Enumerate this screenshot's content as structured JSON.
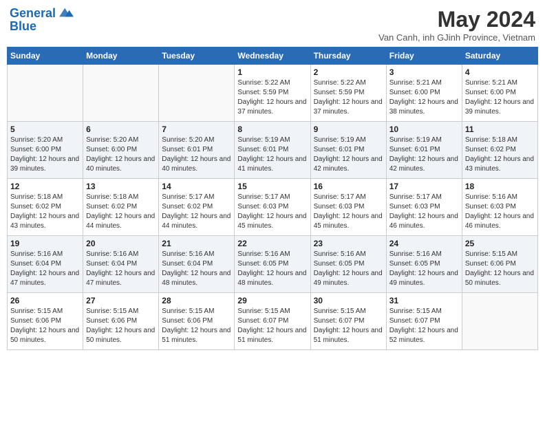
{
  "header": {
    "logo_line1": "General",
    "logo_line2": "Blue",
    "month_title": "May 2024",
    "subtitle": "Van Canh, inh GJinh Province, Vietnam"
  },
  "weekdays": [
    "Sunday",
    "Monday",
    "Tuesday",
    "Wednesday",
    "Thursday",
    "Friday",
    "Saturday"
  ],
  "weeks": [
    [
      {
        "day": "",
        "sunrise": "",
        "sunset": "",
        "daylight": ""
      },
      {
        "day": "",
        "sunrise": "",
        "sunset": "",
        "daylight": ""
      },
      {
        "day": "",
        "sunrise": "",
        "sunset": "",
        "daylight": ""
      },
      {
        "day": "1",
        "sunrise": "Sunrise: 5:22 AM",
        "sunset": "Sunset: 5:59 PM",
        "daylight": "Daylight: 12 hours and 37 minutes."
      },
      {
        "day": "2",
        "sunrise": "Sunrise: 5:22 AM",
        "sunset": "Sunset: 5:59 PM",
        "daylight": "Daylight: 12 hours and 37 minutes."
      },
      {
        "day": "3",
        "sunrise": "Sunrise: 5:21 AM",
        "sunset": "Sunset: 6:00 PM",
        "daylight": "Daylight: 12 hours and 38 minutes."
      },
      {
        "day": "4",
        "sunrise": "Sunrise: 5:21 AM",
        "sunset": "Sunset: 6:00 PM",
        "daylight": "Daylight: 12 hours and 39 minutes."
      }
    ],
    [
      {
        "day": "5",
        "sunrise": "Sunrise: 5:20 AM",
        "sunset": "Sunset: 6:00 PM",
        "daylight": "Daylight: 12 hours and 39 minutes."
      },
      {
        "day": "6",
        "sunrise": "Sunrise: 5:20 AM",
        "sunset": "Sunset: 6:00 PM",
        "daylight": "Daylight: 12 hours and 40 minutes."
      },
      {
        "day": "7",
        "sunrise": "Sunrise: 5:20 AM",
        "sunset": "Sunset: 6:01 PM",
        "daylight": "Daylight: 12 hours and 40 minutes."
      },
      {
        "day": "8",
        "sunrise": "Sunrise: 5:19 AM",
        "sunset": "Sunset: 6:01 PM",
        "daylight": "Daylight: 12 hours and 41 minutes."
      },
      {
        "day": "9",
        "sunrise": "Sunrise: 5:19 AM",
        "sunset": "Sunset: 6:01 PM",
        "daylight": "Daylight: 12 hours and 42 minutes."
      },
      {
        "day": "10",
        "sunrise": "Sunrise: 5:19 AM",
        "sunset": "Sunset: 6:01 PM",
        "daylight": "Daylight: 12 hours and 42 minutes."
      },
      {
        "day": "11",
        "sunrise": "Sunrise: 5:18 AM",
        "sunset": "Sunset: 6:02 PM",
        "daylight": "Daylight: 12 hours and 43 minutes."
      }
    ],
    [
      {
        "day": "12",
        "sunrise": "Sunrise: 5:18 AM",
        "sunset": "Sunset: 6:02 PM",
        "daylight": "Daylight: 12 hours and 43 minutes."
      },
      {
        "day": "13",
        "sunrise": "Sunrise: 5:18 AM",
        "sunset": "Sunset: 6:02 PM",
        "daylight": "Daylight: 12 hours and 44 minutes."
      },
      {
        "day": "14",
        "sunrise": "Sunrise: 5:17 AM",
        "sunset": "Sunset: 6:02 PM",
        "daylight": "Daylight: 12 hours and 44 minutes."
      },
      {
        "day": "15",
        "sunrise": "Sunrise: 5:17 AM",
        "sunset": "Sunset: 6:03 PM",
        "daylight": "Daylight: 12 hours and 45 minutes."
      },
      {
        "day": "16",
        "sunrise": "Sunrise: 5:17 AM",
        "sunset": "Sunset: 6:03 PM",
        "daylight": "Daylight: 12 hours and 45 minutes."
      },
      {
        "day": "17",
        "sunrise": "Sunrise: 5:17 AM",
        "sunset": "Sunset: 6:03 PM",
        "daylight": "Daylight: 12 hours and 46 minutes."
      },
      {
        "day": "18",
        "sunrise": "Sunrise: 5:16 AM",
        "sunset": "Sunset: 6:03 PM",
        "daylight": "Daylight: 12 hours and 46 minutes."
      }
    ],
    [
      {
        "day": "19",
        "sunrise": "Sunrise: 5:16 AM",
        "sunset": "Sunset: 6:04 PM",
        "daylight": "Daylight: 12 hours and 47 minutes."
      },
      {
        "day": "20",
        "sunrise": "Sunrise: 5:16 AM",
        "sunset": "Sunset: 6:04 PM",
        "daylight": "Daylight: 12 hours and 47 minutes."
      },
      {
        "day": "21",
        "sunrise": "Sunrise: 5:16 AM",
        "sunset": "Sunset: 6:04 PM",
        "daylight": "Daylight: 12 hours and 48 minutes."
      },
      {
        "day": "22",
        "sunrise": "Sunrise: 5:16 AM",
        "sunset": "Sunset: 6:05 PM",
        "daylight": "Daylight: 12 hours and 48 minutes."
      },
      {
        "day": "23",
        "sunrise": "Sunrise: 5:16 AM",
        "sunset": "Sunset: 6:05 PM",
        "daylight": "Daylight: 12 hours and 49 minutes."
      },
      {
        "day": "24",
        "sunrise": "Sunrise: 5:16 AM",
        "sunset": "Sunset: 6:05 PM",
        "daylight": "Daylight: 12 hours and 49 minutes."
      },
      {
        "day": "25",
        "sunrise": "Sunrise: 5:15 AM",
        "sunset": "Sunset: 6:06 PM",
        "daylight": "Daylight: 12 hours and 50 minutes."
      }
    ],
    [
      {
        "day": "26",
        "sunrise": "Sunrise: 5:15 AM",
        "sunset": "Sunset: 6:06 PM",
        "daylight": "Daylight: 12 hours and 50 minutes."
      },
      {
        "day": "27",
        "sunrise": "Sunrise: 5:15 AM",
        "sunset": "Sunset: 6:06 PM",
        "daylight": "Daylight: 12 hours and 50 minutes."
      },
      {
        "day": "28",
        "sunrise": "Sunrise: 5:15 AM",
        "sunset": "Sunset: 6:06 PM",
        "daylight": "Daylight: 12 hours and 51 minutes."
      },
      {
        "day": "29",
        "sunrise": "Sunrise: 5:15 AM",
        "sunset": "Sunset: 6:07 PM",
        "daylight": "Daylight: 12 hours and 51 minutes."
      },
      {
        "day": "30",
        "sunrise": "Sunrise: 5:15 AM",
        "sunset": "Sunset: 6:07 PM",
        "daylight": "Daylight: 12 hours and 51 minutes."
      },
      {
        "day": "31",
        "sunrise": "Sunrise: 5:15 AM",
        "sunset": "Sunset: 6:07 PM",
        "daylight": "Daylight: 12 hours and 52 minutes."
      },
      {
        "day": "",
        "sunrise": "",
        "sunset": "",
        "daylight": ""
      }
    ]
  ]
}
